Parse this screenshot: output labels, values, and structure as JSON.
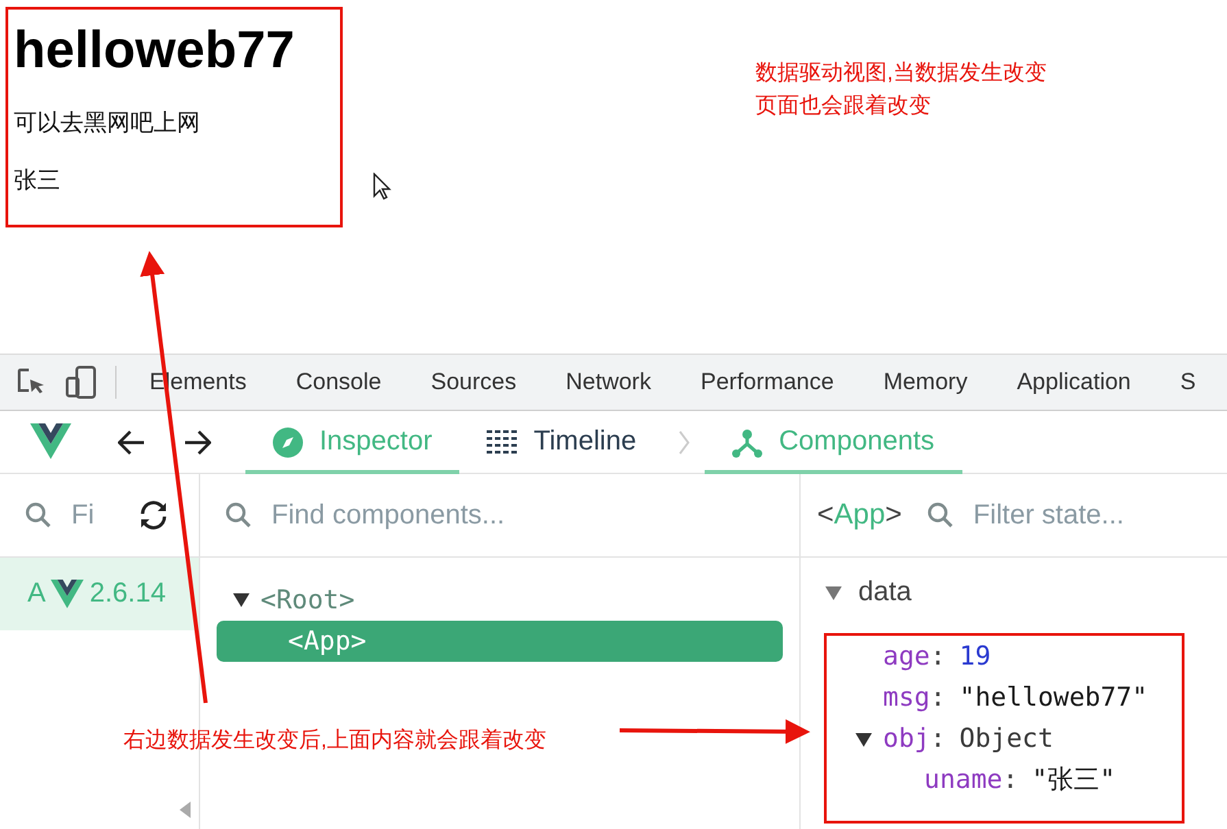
{
  "page": {
    "heading": "helloweb77",
    "message": "可以去黑网吧上网",
    "name": "张三"
  },
  "note_top": [
    "数据驱动视图,当数据发生改变",
    "页面也会跟着改变"
  ],
  "note_bottom": "右边数据发生改变后,上面内容就会跟着改变",
  "devtools_tabs": [
    "Elements",
    "Console",
    "Sources",
    "Network",
    "Performance",
    "Memory",
    "Application",
    "S"
  ],
  "vue_tabs": [
    {
      "label": "Inspector",
      "selected": true
    },
    {
      "label": "Timeline",
      "selected": false
    },
    {
      "label": "Components",
      "selected": true
    }
  ],
  "left_search": {
    "placeholder": "Fi"
  },
  "apps": [
    {
      "label": "A",
      "version": "2.6.14",
      "selected": true
    }
  ],
  "component_search": {
    "placeholder": "Find components..."
  },
  "tree": [
    {
      "label": "<Root>",
      "expanded": true,
      "selected": false,
      "children": [
        {
          "label": "<App>",
          "selected": true
        }
      ]
    }
  ],
  "state_panel": {
    "title_parts": [
      "<",
      "App",
      ">"
    ],
    "filter": {
      "placeholder": "Filter state..."
    },
    "sections": [
      {
        "name": "data",
        "expanded": true,
        "fields": [
          {
            "key": "age",
            "sep": ":",
            "kind": "number",
            "value": "19"
          },
          {
            "key": "msg",
            "sep": ":",
            "kind": "string",
            "value": "\"helloweb77\""
          },
          {
            "key": "obj",
            "sep": ":",
            "kind": "object",
            "value": "Object",
            "expanded": true,
            "children": [
              {
                "key": "uname",
                "sep": ":",
                "kind": "string",
                "value": "\"张三\""
              }
            ]
          }
        ]
      }
    ]
  }
}
